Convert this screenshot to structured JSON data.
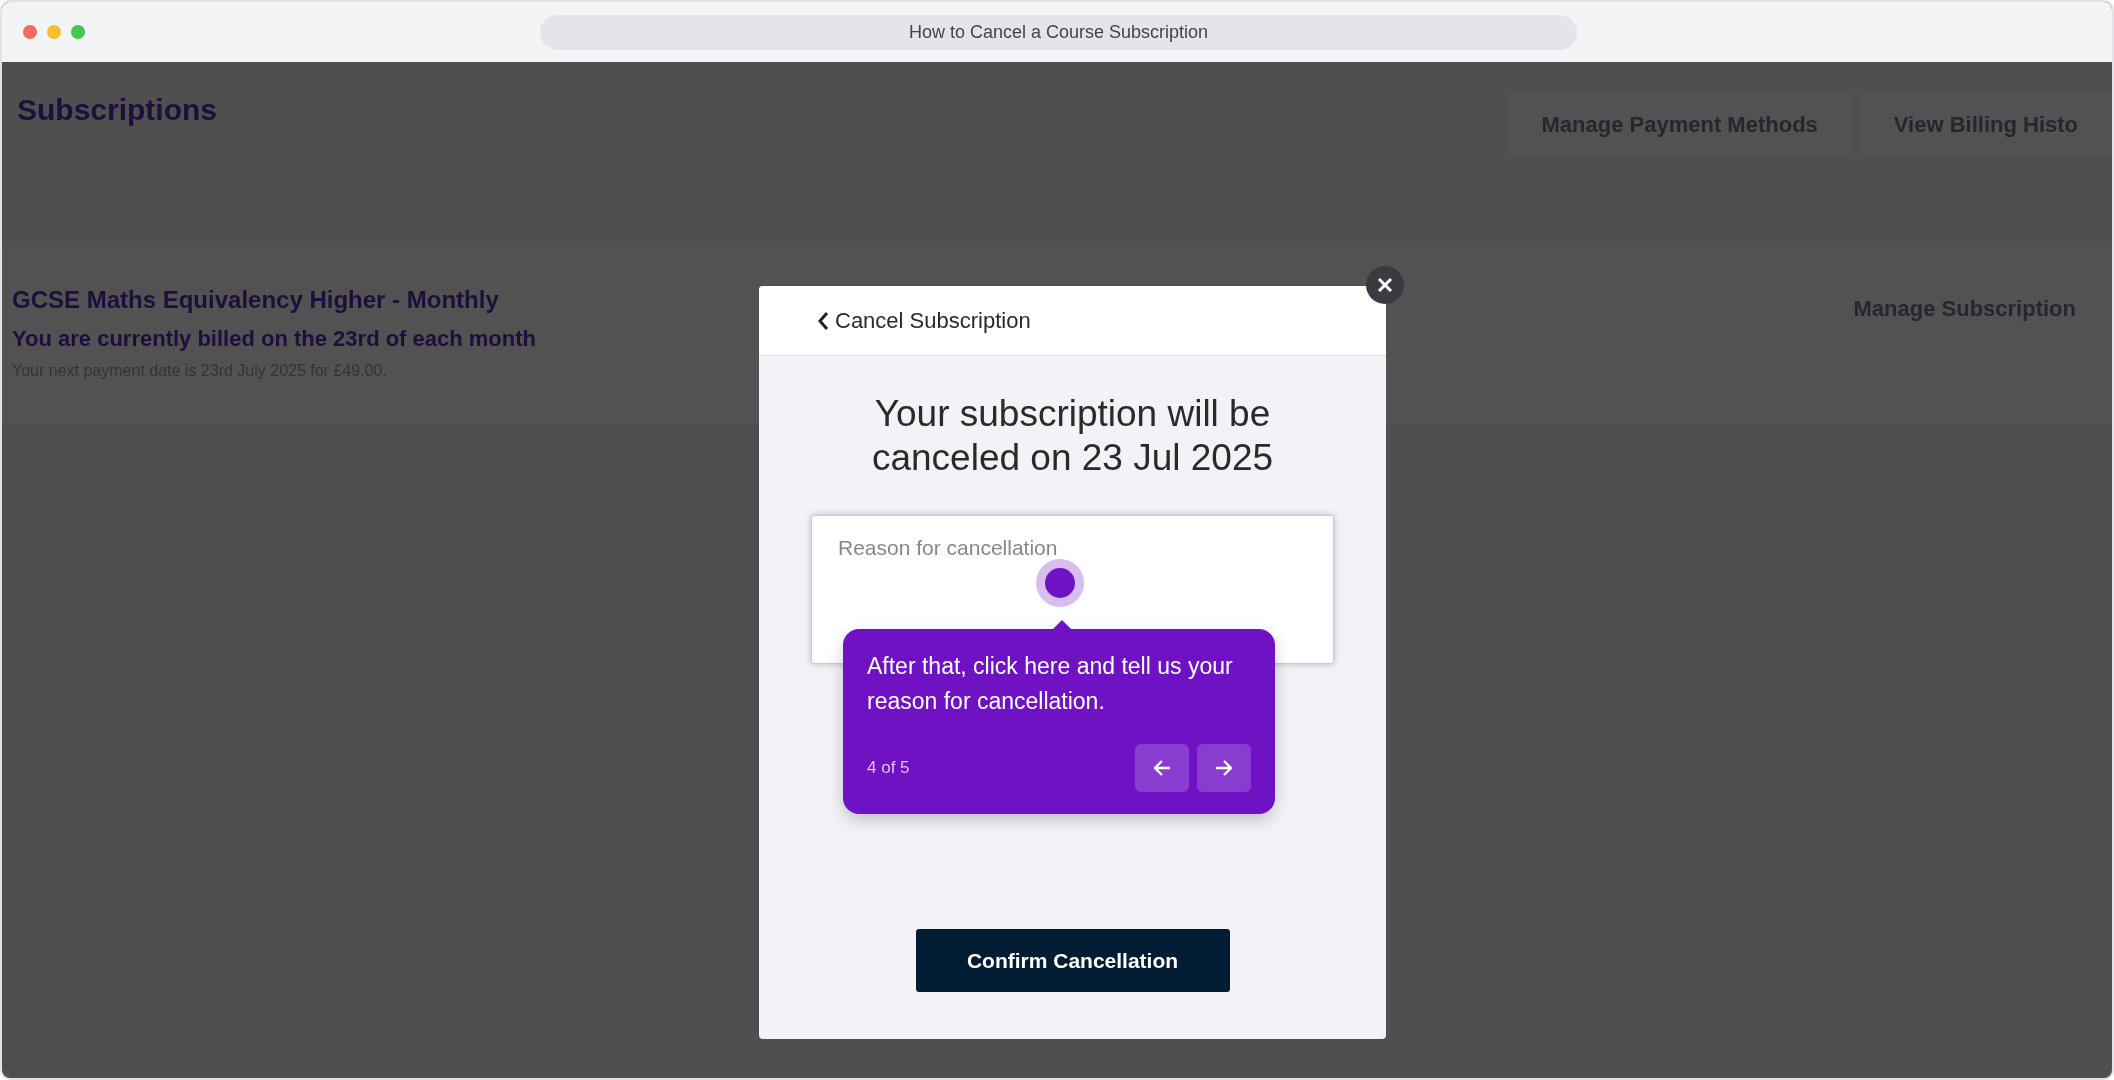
{
  "window": {
    "title": "How to Cancel a Course Subscription"
  },
  "page": {
    "heading": "Subscriptions",
    "header_buttons": [
      "Manage Payment Methods",
      "View Billing Histo"
    ],
    "subscription": {
      "name": "GCSE Maths Equivalency Higher - Monthly",
      "billing": "You are currently billed on the 23rd of each month",
      "next_payment": "Your next payment date is 23rd July 2025 for £49.00.",
      "button": "Manage Subscription"
    }
  },
  "modal": {
    "back_label": "Cancel Subscription",
    "message": "Your subscription will be canceled on 23 Jul 2025",
    "reason": {
      "placeholder": "Reason for cancellation"
    },
    "confirm_button": "Confirm Cancellation"
  },
  "tour": {
    "text": "After that, click here and tell us your reason for cancellation.",
    "step": "4 of 5"
  }
}
